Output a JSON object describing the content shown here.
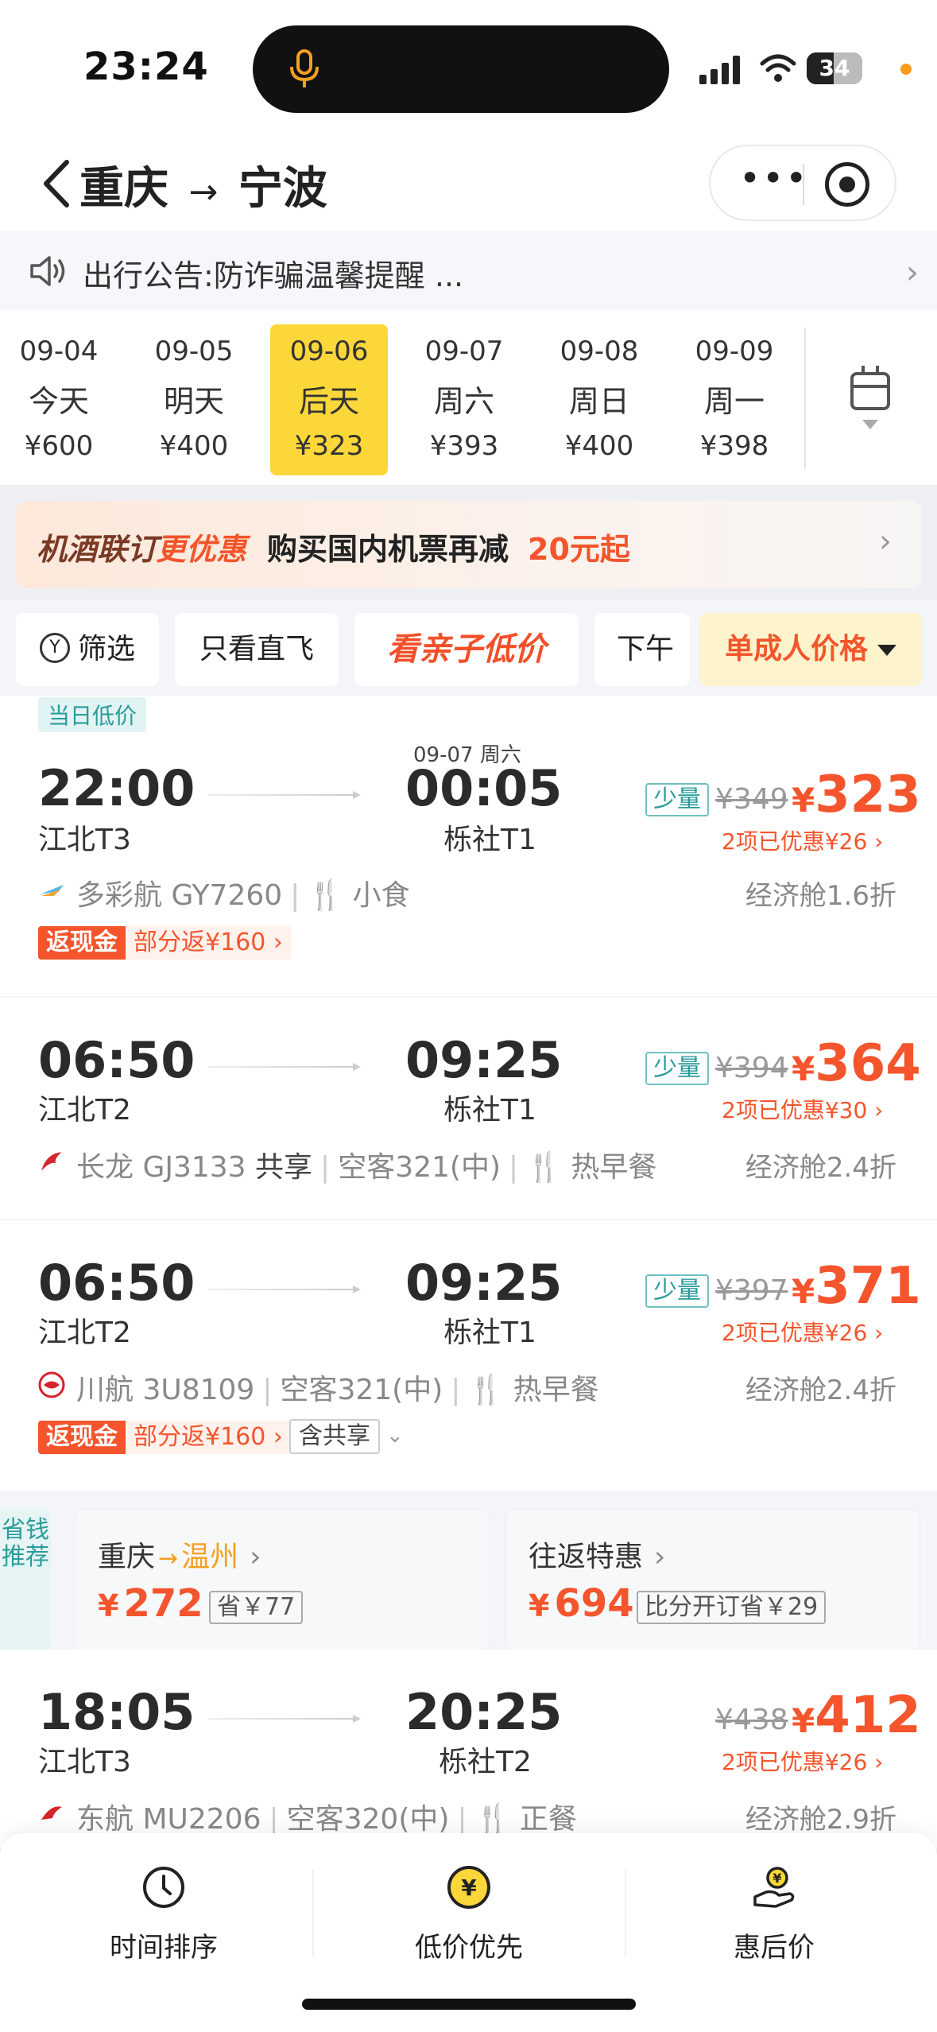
{
  "status": {
    "time": "23:24",
    "battery": "34"
  },
  "header": {
    "from": "重庆",
    "to": "宁波",
    "arrow": "→"
  },
  "notice": {
    "text": "出行公告:防诈骗温馨提醒 ...",
    "arrow": "›"
  },
  "dates": [
    {
      "date": "09-04",
      "weekday": "今天",
      "price": "¥600",
      "selected": false
    },
    {
      "date": "09-05",
      "weekday": "明天",
      "price": "¥400",
      "selected": false
    },
    {
      "date": "09-06",
      "weekday": "后天",
      "price": "¥323",
      "selected": true
    },
    {
      "date": "09-07",
      "weekday": "周六",
      "price": "¥393",
      "selected": false
    },
    {
      "date": "09-08",
      "weekday": "周日",
      "price": "¥400",
      "selected": false
    },
    {
      "date": "09-09",
      "weekday": "周一",
      "price": "¥398",
      "selected": false
    }
  ],
  "promo": {
    "part1": "机酒联订",
    "part2": "更优惠",
    "part3": "购买国内机票再减",
    "part4": "20元起",
    "arrow": "›"
  },
  "filters": {
    "filter": "筛选",
    "direct": "只看直飞",
    "kids": "看亲子低价",
    "afternoon": "下午出",
    "price_mode": "单成人价格"
  },
  "flights": [
    {
      "tag": "当日低价",
      "dep_time": "22:00",
      "dep_airport": "江北T3",
      "arr_time": "00:05",
      "arr_airport": "栎社T1",
      "next_day": "09-07 周六",
      "few": "少量",
      "orig_price": "¥349",
      "currency": "¥",
      "price": "323",
      "discount": "2项已优惠¥26 ›",
      "airline": "多彩航 GY7260",
      "share": "",
      "aircraft": "",
      "meal": "小食",
      "cabin": "经济舱1.6折",
      "cash_label": "返现金",
      "cash_text": "部分返¥160 ›"
    },
    {
      "dep_time": "06:50",
      "dep_airport": "江北T2",
      "arr_time": "09:25",
      "arr_airport": "栎社T1",
      "few": "少量",
      "orig_price": "¥394",
      "currency": "¥",
      "price": "364",
      "discount": "2项已优惠¥30 ›",
      "airline": "长龙 GJ3133",
      "share": "共享",
      "aircraft": "空客321(中)",
      "meal": "热早餐",
      "cabin": "经济舱2.4折"
    },
    {
      "dep_time": "06:50",
      "dep_airport": "江北T2",
      "arr_time": "09:25",
      "arr_airport": "栎社T1",
      "few": "少量",
      "orig_price": "¥397",
      "currency": "¥",
      "price": "371",
      "discount": "2项已优惠¥26 ›",
      "airline": "川航 3U8109",
      "share": "",
      "aircraft": "空客321(中)",
      "meal": "热早餐",
      "cabin": "经济舱2.4折",
      "cash_label": "返现金",
      "cash_text": "部分返¥160 ›",
      "share_tag": "含共享"
    },
    {
      "dep_time": "18:05",
      "dep_airport": "江北T3",
      "arr_time": "20:25",
      "arr_airport": "栎社T2",
      "orig_price": "¥438",
      "currency": "¥",
      "price": "412",
      "discount": "2项已优惠¥26 ›",
      "airline": "东航 MU2206",
      "aircraft": "空客320(中)",
      "meal": "正餐",
      "cabin": "经济舱2.9折"
    }
  ],
  "recommend": {
    "side": "省钱推荐",
    "box1": {
      "from": "重庆",
      "to": "温州",
      "arrow": "›",
      "currency": "¥",
      "price": "272",
      "save": "省￥77"
    },
    "box2": {
      "title": "往返特惠",
      "arrow": "›",
      "currency": "¥",
      "price": "694",
      "save": "比分开订省￥29"
    }
  },
  "bottom_nav": [
    {
      "label": "时间排序",
      "icon": "clock-icon"
    },
    {
      "label": "低价优先",
      "icon": "yen-coin-icon"
    },
    {
      "label": "惠后价",
      "icon": "hand-coin-icon"
    }
  ],
  "colors": {
    "accent": "#f4552c",
    "selected_date": "#fbd739",
    "teal": "#2a9c9a"
  }
}
